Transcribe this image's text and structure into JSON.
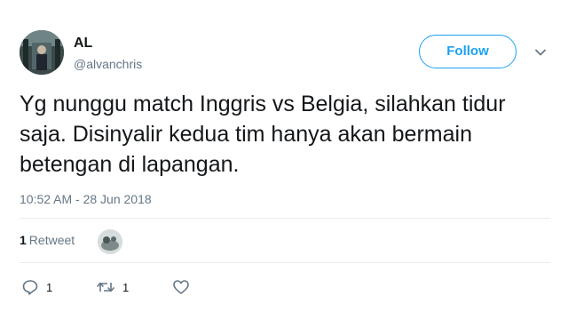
{
  "user": {
    "name": "AL",
    "handle": "@alvanchris"
  },
  "follow_button": {
    "label": "Follow",
    "color": "#1da1f2"
  },
  "tweet": {
    "text": "Yg nunggu match Inggris vs Belgia, silahkan tidur saja. Disinyalir kedua tim hanya akan bermain betengan di lapangan.",
    "timestamp": "10:52 AM - 28 Jun 2018"
  },
  "stats": {
    "retweet_count": "1",
    "retweet_label": "Retweet"
  },
  "actions": {
    "reply_count": "1",
    "retweet_count": "1",
    "like_count": ""
  },
  "icons": {
    "avatar": "avatar-image",
    "menu": "chevron-down-icon",
    "reply": "reply-icon",
    "retweet": "retweet-icon",
    "like": "heart-icon"
  },
  "colors": {
    "text": "#14171a",
    "secondary": "#657786",
    "divider": "#e6ecf0"
  }
}
